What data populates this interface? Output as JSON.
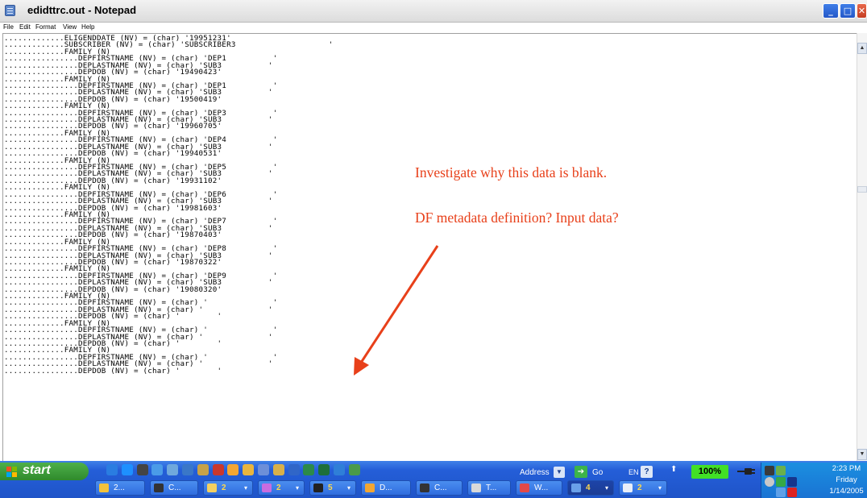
{
  "window": {
    "title": "edidttrc.out - Notepad",
    "controls": {
      "minimize": "_",
      "maximize": "□",
      "close": "✕"
    }
  },
  "menu": [
    "File",
    "Edit",
    "Format",
    "View",
    "Help"
  ],
  "document": {
    "lines": [
      ".............ELIGENDDATE (NV) = (char) '19951231'",
      ".............SUBSCRIBER (NV) = (char) 'SUBSCRIBER3                    '",
      ".............FAMILY (N)",
      "................DEPFIRSTNAME (NV) = (char) 'DEP1          '",
      "................DEPLASTNAME (NV) = (char) 'SUB3          '",
      "................DEPDOB (NV) = (char) '19490423'",
      ".............FAMILY (N)",
      "................DEPFIRSTNAME (NV) = (char) 'DEP1          '",
      "................DEPLASTNAME (NV) = (char) 'SUB3          '",
      "................DEPDOB (NV) = (char) '19500419'",
      ".............FAMILY (N)",
      "................DEPFIRSTNAME (NV) = (char) 'DEP3          '",
      "................DEPLASTNAME (NV) = (char) 'SUB3          '",
      "................DEPDOB (NV) = (char) '19960705'",
      ".............FAMILY (N)",
      "................DEPFIRSTNAME (NV) = (char) 'DEP4          '",
      "................DEPLASTNAME (NV) = (char) 'SUB3          '",
      "................DEPDOB (NV) = (char) '19940531'",
      ".............FAMILY (N)",
      "................DEPFIRSTNAME (NV) = (char) 'DEP5          '",
      "................DEPLASTNAME (NV) = (char) 'SUB3          '",
      "................DEPDOB (NV) = (char) '19931102'",
      ".............FAMILY (N)",
      "................DEPFIRSTNAME (NV) = (char) 'DEP6          '",
      "................DEPLASTNAME (NV) = (char) 'SUB3          '",
      "................DEPDOB (NV) = (char) '19981603'",
      ".............FAMILY (N)",
      "................DEPFIRSTNAME (NV) = (char) 'DEP7          '",
      "................DEPLASTNAME (NV) = (char) 'SUB3          '",
      "................DEPDOB (NV) = (char) '19870403'",
      ".............FAMILY (N)",
      "................DEPFIRSTNAME (NV) = (char) 'DEP8          '",
      "................DEPLASTNAME (NV) = (char) 'SUB3          '",
      "................DEPDOB (NV) = (char) '19870322'",
      ".............FAMILY (N)",
      "................DEPFIRSTNAME (NV) = (char) 'DEP9          '",
      "................DEPLASTNAME (NV) = (char) 'SUB3          '",
      "................DEPDOB (NV) = (char) '19080320'",
      ".............FAMILY (N)",
      "................DEPFIRSTNAME (NV) = (char) '              '",
      "................DEPLASTNAME (NV) = (char) '              '",
      "................DEPDOB (NV) = (char) '        '",
      ".............FAMILY (N)",
      "................DEPFIRSTNAME (NV) = (char) '              '",
      "................DEPLASTNAME (NV) = (char) '              '",
      "................DEPDOB (NV) = (char) '        '",
      ".............FAMILY (N)",
      "................DEPFIRSTNAME (NV) = (char) '              '",
      "................DEPLASTNAME (NV) = (char) '              '",
      "................DEPDOB (NV) = (char) '        '"
    ]
  },
  "annotation": {
    "line1": "Investigate why this data is blank.",
    "line2": "DF metadata definition? Input data?",
    "color": "#e8401a"
  },
  "taskbar": {
    "start_label": "start",
    "quick_launch_icons": [
      "ie-icon",
      "browser-icon",
      "terminal-icon",
      "explorer-icon",
      "notepad-icon",
      "search-icon",
      "people-icon",
      "triangle-icon",
      "sun-icon",
      "folder-icon",
      "package-icon",
      "network-icon",
      "word-icon",
      "chart-icon",
      "mail-icon",
      "paint-icon",
      "globe-icon"
    ],
    "address_label": "Address",
    "go_label": "Go",
    "language": "EN",
    "zoom": "100%",
    "clock": {
      "time": "2:23 PM",
      "day": "Friday",
      "date": "1/14/2005"
    },
    "tasks": [
      {
        "label": "2...",
        "count": "",
        "icon": "emoticon-icon",
        "color": "#f2c23a",
        "dropdown": false,
        "active": false
      },
      {
        "label": "C...",
        "count": "",
        "icon": "terminal-icon",
        "color": "#333333",
        "dropdown": false,
        "active": false
      },
      {
        "label": "",
        "count": "2",
        "icon": "folder-icon",
        "color": "#f3d061",
        "dropdown": true,
        "active": false
      },
      {
        "label": "",
        "count": "2",
        "icon": "globe-icon",
        "color": "#c86ce0",
        "dropdown": true,
        "active": false
      },
      {
        "label": "",
        "count": "5",
        "icon": "console-icon",
        "color": "#222222",
        "dropdown": true,
        "active": false
      },
      {
        "label": "D...",
        "count": "",
        "icon": "sun-icon",
        "color": "#f3a632",
        "dropdown": false,
        "active": false
      },
      {
        "label": "C...",
        "count": "",
        "icon": "terminal-icon",
        "color": "#333333",
        "dropdown": false,
        "active": false
      },
      {
        "label": "T...",
        "count": "",
        "icon": "document-icon",
        "color": "#d9d9d9",
        "dropdown": false,
        "active": false
      },
      {
        "label": "W...",
        "count": "",
        "icon": "people-icon",
        "color": "#e24848",
        "dropdown": false,
        "active": false
      },
      {
        "label": "",
        "count": "4",
        "icon": "window-icon",
        "color": "#6aa0e8",
        "dropdown": true,
        "active": true
      },
      {
        "label": "",
        "count": "2",
        "icon": "notepad-icon",
        "color": "#e8eef8",
        "dropdown": true,
        "active": false
      }
    ]
  }
}
